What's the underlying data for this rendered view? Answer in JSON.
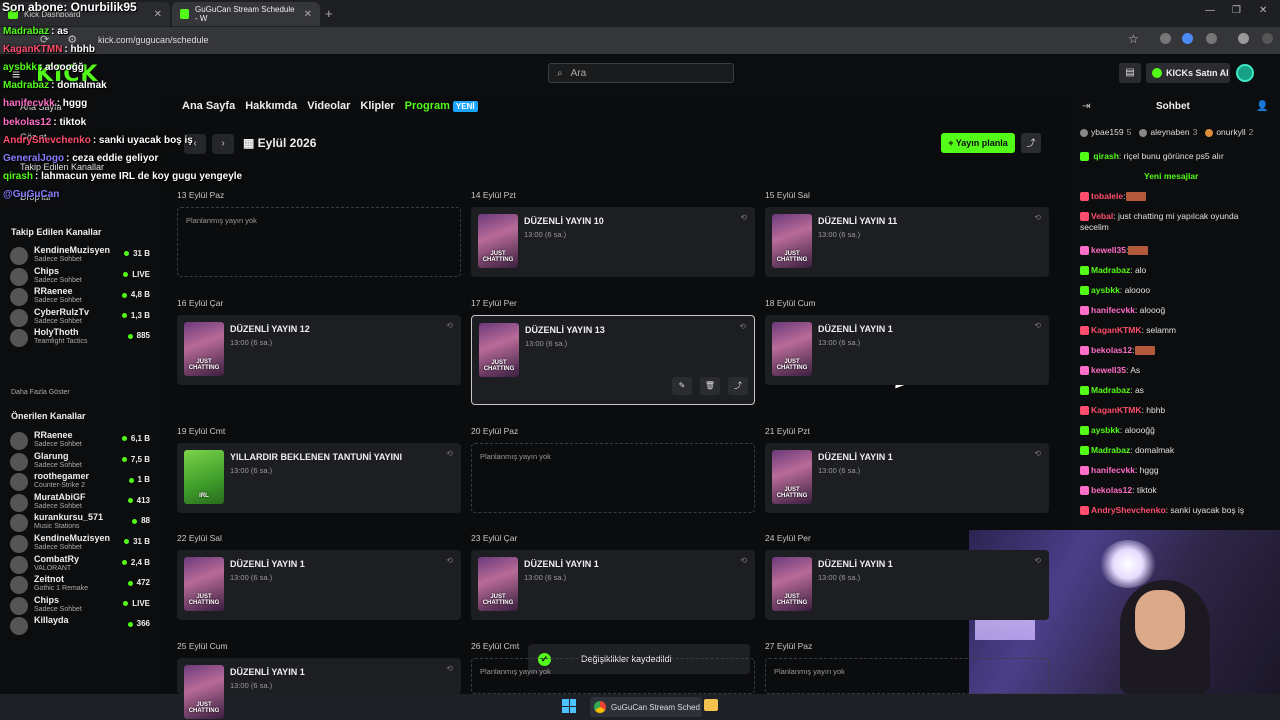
{
  "browser": {
    "tab1_title": "Kick Dashboard",
    "tab2_title": "GuGuCan Stream Schedule - W",
    "url": "kick.com/gugucan/schedule"
  },
  "header": {
    "search_placeholder": "Ara",
    "buy_label": "KICKs Satın Al"
  },
  "overlay": {
    "sub_text": "Son abone: Onurbilik95",
    "messages": [
      {
        "user": "Madrabaz",
        "text": ": as",
        "color": "#53fc18"
      },
      {
        "user": "KaganKTMN",
        "text": ": hbhb",
        "color": "#ff4d6d"
      },
      {
        "user": "aysbkk",
        "text": ": aloooğğ",
        "color": "#53fc18"
      },
      {
        "user": "Madrabaz",
        "text": ": domalmak",
        "color": "#53fc18"
      },
      {
        "user": "hanifecvkk",
        "text": ": hggg",
        "color": "#ff6ec7"
      },
      {
        "user": "bekolas12",
        "text": ": tiktok",
        "color": "#ff6ec7"
      },
      {
        "user": "AndryShevchenko",
        "text": ": sanki uyacak boş iş",
        "color": "#ff4d6d"
      },
      {
        "user": "GeneralJogo",
        "text": ": ceza eddie geliyor",
        "color": "#8a7cff"
      },
      {
        "user": "qirash",
        "text": ": lahmacun yeme IRL de koy gugu yengeyle",
        "color": "#53fc18"
      },
      {
        "user": "@GuGuCan",
        "text": "",
        "color": "#8a7cff"
      }
    ]
  },
  "sidebar": {
    "nav": [
      "Ana Sayfa",
      "Göz at",
      "Takip Edilen Kanallar",
      "Drop'lar"
    ],
    "followed_title": "Takip Edilen Kanallar",
    "followed": [
      {
        "name": "KendineMuzisyen",
        "category": "Sadece Sohbet",
        "count": "31 B"
      },
      {
        "name": "Chips",
        "category": "Sadece Sohbet",
        "count": "LIVE"
      },
      {
        "name": "RRaenee",
        "category": "Sadece Sohbet",
        "count": "4,8 B"
      },
      {
        "name": "CyberRulzTv",
        "category": "Sadece Sohbet",
        "count": "1,3 B"
      },
      {
        "name": "HolyThoth",
        "category": "Teamfight Tactics",
        "count": "885"
      }
    ],
    "show_more": "Daha Fazla Göster",
    "recommended_title": "Önerilen Kanallar",
    "recommended": [
      {
        "name": "RRaenee",
        "category": "Sadece Sohbet",
        "count": "6,1 B"
      },
      {
        "name": "Glarung",
        "category": "Sadece Sohbet",
        "count": "7,5 B"
      },
      {
        "name": "roothegamer",
        "category": "Counter-Strike 2",
        "count": "1 B"
      },
      {
        "name": "MuratAbiGF",
        "category": "Sadece Sohbet",
        "count": "413"
      },
      {
        "name": "kurankursu_571",
        "category": "Music Stations",
        "count": "88"
      },
      {
        "name": "KendineMuzisyen",
        "category": "Sadece Sohbet",
        "count": "31 B"
      },
      {
        "name": "CombatRy",
        "category": "VALORANT",
        "count": "2,4 B"
      },
      {
        "name": "Zeitnot",
        "category": "Gothic 1 Remake",
        "count": "472"
      },
      {
        "name": "Chips",
        "category": "Sadece Sohbet",
        "count": "LIVE"
      },
      {
        "name": "Killayda",
        "category": "",
        "count": "366"
      }
    ]
  },
  "channel_nav": {
    "home": "Ana Sayfa",
    "about": "Hakkımda",
    "videos": "Videolar",
    "clips": "Klipler",
    "program": "Program",
    "new_badge": "YENİ"
  },
  "schedule": {
    "month": "Eylül 2026",
    "plan_button": "Yayın planla",
    "empty_text": "Planlanmış yayın yok",
    "thumb_just": "JUST CHATTING",
    "thumb_irl": "IRL",
    "days": [
      {
        "label": "13 Eylül Paz",
        "title": "",
        "time": ""
      },
      {
        "label": "14 Eylül Pzt",
        "title": "DÜZENLİ YAYIN 10",
        "time": "13:00 (6 sa.)"
      },
      {
        "label": "15 Eylül Sal",
        "title": "DÜZENLİ YAYIN 11",
        "time": "13:00 (6 sa.)"
      },
      {
        "label": "16 Eylül Çar",
        "title": "DÜZENLİ YAYIN 12",
        "time": "13:00 (6 sa.)"
      },
      {
        "label": "17 Eylül Per",
        "title": "DÜZENLİ YAYIN 13",
        "time": "13:00 (6 sa.)"
      },
      {
        "label": "18 Eylül Cum",
        "title": "DÜZENLİ YAYIN 1",
        "time": "13:00 (6 sa.)"
      },
      {
        "label": "19 Eylül Cmt",
        "title": "YILLARDIR BEKLENEN TANTUNİ YAYINI",
        "time": "13:00 (6 sa.)"
      },
      {
        "label": "20 Eylül Paz",
        "title": "",
        "time": ""
      },
      {
        "label": "21 Eylül Pzt",
        "title": "DÜZENLİ YAYIN 1",
        "time": "13:00 (6 sa.)"
      },
      {
        "label": "22 Eylül Sal",
        "title": "DÜZENLİ YAYIN 1",
        "time": "13:00 (6 sa.)"
      },
      {
        "label": "23 Eylül Çar",
        "title": "DÜZENLİ YAYIN 1",
        "time": "13:00 (6 sa.)"
      },
      {
        "label": "24 Eylül Per",
        "title": "DÜZENLİ YAYIN 1",
        "time": "13:00 (6 sa.)"
      },
      {
        "label": "25 Eylül Cum",
        "title": "DÜZENLİ YAYIN 1",
        "time": "13:00 (6 sa.)"
      },
      {
        "label": "26 Eylül Cmt",
        "title": "",
        "time": ""
      },
      {
        "label": "27 Eylül Paz",
        "title": "",
        "time": ""
      }
    ]
  },
  "chat": {
    "title": "Sohbet",
    "top_users": [
      {
        "name": "ybae159",
        "count": "5",
        "color": "#888"
      },
      {
        "name": "aleynaben",
        "count": "3",
        "color": "#888"
      },
      {
        "name": "onurkyll",
        "count": "2",
        "color": "#d98b3a"
      }
    ],
    "pinned": {
      "user": "qirash",
      "text": ": riçel bunu görünce ps5 alır",
      "color": "#53fc18"
    },
    "new_messages": "Yeni mesajlar",
    "messages": [
      {
        "user": "tobalele",
        "text": ":",
        "color": "#ff4d6d",
        "emote": true
      },
      {
        "user": "Vebal",
        "text": ": just chatting mi yapılcak oyunda secelim",
        "color": "#ff4d6d"
      },
      {
        "user": "kewell35",
        "text": ":",
        "color": "#ff6ec7",
        "emote": true
      },
      {
        "user": "Madrabaz",
        "text": ": alo",
        "color": "#53fc18"
      },
      {
        "user": "aysbkk",
        "text": ": aloooo",
        "color": "#53fc18"
      },
      {
        "user": "hanifecvkk",
        "text": ": aloooğ",
        "color": "#ff6ec7"
      },
      {
        "user": "KaganKTMK",
        "text": ": selamm",
        "color": "#ff4d6d"
      },
      {
        "user": "bekolas12",
        "text": ":",
        "color": "#ff6ec7",
        "emote": true
      },
      {
        "user": "kewell35",
        "text": ": As",
        "color": "#ff6ec7"
      },
      {
        "user": "Madrabaz",
        "text": ": as",
        "color": "#53fc18"
      },
      {
        "user": "KaganKTMK",
        "text": ": hbhb",
        "color": "#ff4d6d"
      },
      {
        "user": "aysbkk",
        "text": ": aloooğğ",
        "color": "#53fc18"
      },
      {
        "user": "Madrabaz",
        "text": ": domalmak",
        "color": "#53fc18"
      },
      {
        "user": "hanifecvkk",
        "text": ": hggg",
        "color": "#ff6ec7"
      },
      {
        "user": "bekolas12",
        "text": ": tiktok",
        "color": "#ff6ec7"
      },
      {
        "user": "AndryShevchenko",
        "text": ": sanki uyacak boş iş",
        "color": "#ff4d6d"
      }
    ]
  },
  "toast": {
    "text": "Değişiklikler kaydedildi"
  },
  "taskbar": {
    "chrome_label": "GuGuCan Stream Sched"
  },
  "colors": {
    "accent": "#53fc18",
    "background": "#0b0c0d",
    "card": "#1c1e21"
  }
}
